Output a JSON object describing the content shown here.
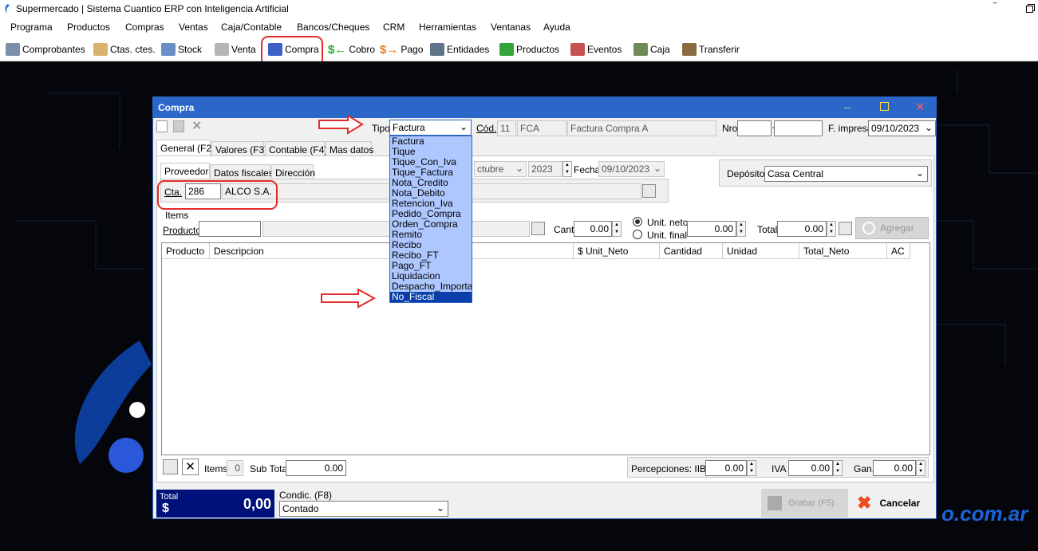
{
  "window": {
    "title": "Supermercado | Sistema Cuantico ERP con Inteligencia Artificial"
  },
  "menu": [
    "Programa",
    "Productos",
    "Compras",
    "Ventas",
    "Caja/Contable",
    "Bancos/Cheques",
    "CRM",
    "Herramientas",
    "Ventanas",
    "Ayuda"
  ],
  "toolbar": {
    "comprobantes": "Comprobantes",
    "ctas": "Ctas. ctes.",
    "stock": "Stock",
    "venta": "Venta",
    "compra": "Compra",
    "cobro": "Cobro",
    "pago": "Pago",
    "entidades": "Entidades",
    "productos": "Productos",
    "eventos": "Eventos",
    "caja": "Caja",
    "transferir": "Transferir"
  },
  "desktop": {
    "watermark": "o.com.ar"
  },
  "dialog": {
    "title": "Compra",
    "tipo_label": "Tipo",
    "tipo_value": "Factura",
    "cod_label": "Cód.",
    "cod_num": "11",
    "cod_code": "FCA",
    "cod_desc": "Factura Compra A",
    "nro_label": "Nro",
    "nro_a": "",
    "nro_b": "",
    "fimpresa_label": "F. impresa",
    "fimpresa_value": "09/10/2023",
    "tabs": [
      "General (F2)",
      "Valores (F3)",
      "Contable (F4)",
      "Mas datos"
    ],
    "subtabs": [
      "Proveedor",
      "Datos fiscales",
      "Dirección"
    ],
    "periodo_month": "ctubre",
    "periodo_year": "2023",
    "fecha_label": "Fecha",
    "fecha_value": "09/10/2023",
    "deposito_label": "Depósito",
    "deposito_value": "Casa Central",
    "cta_label": "Cta.",
    "cta_value": "286",
    "cta_name": "ALCO S.A.",
    "items_group": "Items",
    "producto_label": "Producto",
    "cant_label": "Cant.",
    "cant_value": "0.00",
    "unit_neto": "Unit. neto",
    "unit_final": "Unit. final",
    "unit_value": "0.00",
    "total_label": "Total",
    "total_value": "0.00",
    "agregar": "Agregar",
    "grid_columns": [
      "Producto",
      "Descripcion",
      "$ Unit_Neto",
      "Cantidad",
      "Unidad",
      "Total_Neto",
      "AC"
    ],
    "items_label": "Items",
    "items_count": "0",
    "subtotal_label": "Sub Total",
    "subtotal_value": "0.00",
    "percepciones_label": "Percepciones: IIBB",
    "percepciones_value": "0.00",
    "iva_label": "IVA",
    "iva_value": "0.00",
    "gan_label": "Gan.",
    "gan_value": "0.00",
    "total_box_label": "Total",
    "total_box_currency": "$",
    "total_box_value": "0,00",
    "condic_label": "Condic. (F8)",
    "condic_value": "Contado",
    "grabar": "Grabar (F5)",
    "cancelar": "Cancelar"
  },
  "tipo_options": [
    "Factura",
    "Tique",
    "Tique_Con_Iva",
    "Tique_Factura",
    "Nota_Credito",
    "Nota_Debito",
    "Retencion_Iva",
    "Pedido_Compra",
    "Orden_Compra",
    "Remito",
    "Recibo",
    "Recibo_FT",
    "Pago_FT",
    "Liquidacion",
    "Despacho_Importacion",
    "No_Fiscal"
  ],
  "tipo_selected": "No_Fiscal",
  "colors": {
    "title_blue": "#2b67c8",
    "highlight": "#0a3ea9",
    "dropdown_bg": "#aec7ff",
    "annotation_red": "#e32b2b",
    "total_bg": "#00127a"
  }
}
